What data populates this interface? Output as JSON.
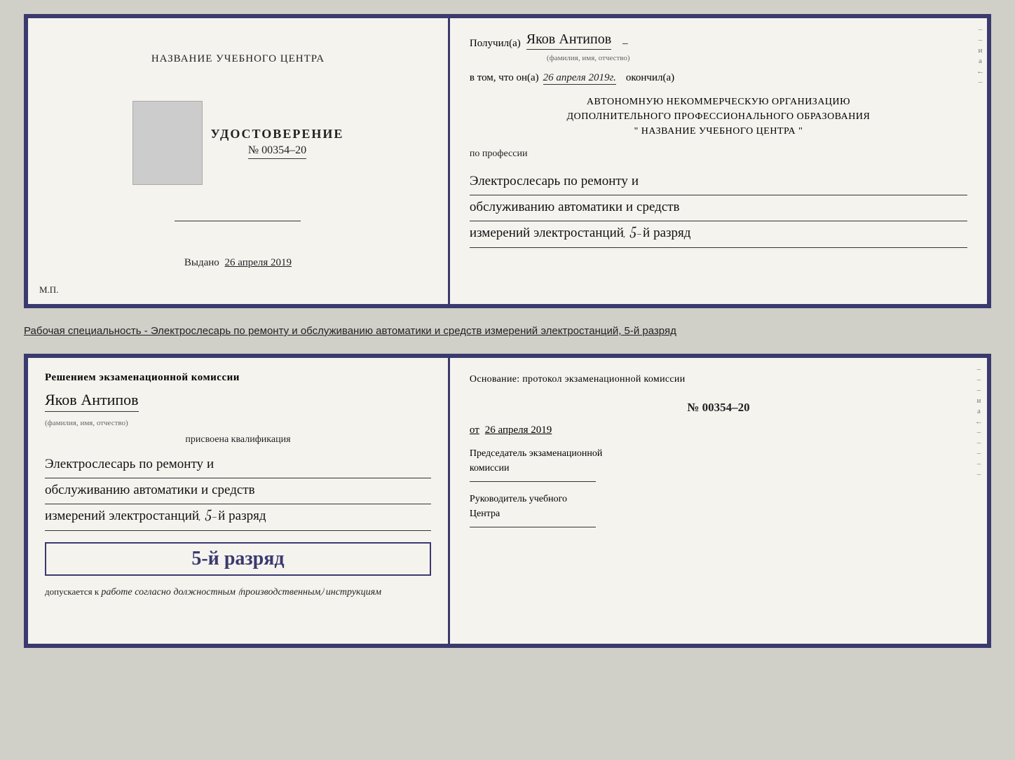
{
  "topDoc": {
    "left": {
      "centerTitle": "НАЗВАНИЕ УЧЕБНОГО ЦЕНТРА",
      "udost": {
        "title": "УДОСТОВЕРЕНИЕ",
        "number": "№ 00354–20"
      },
      "vydano": "Выдано",
      "vydano_date": "26 апреля 2019",
      "mp_label": "М.П."
    },
    "right": {
      "poluchil_prefix": "Получил(а)",
      "poluchil_name": "Яков Антипов",
      "fio_sub": "(фамилия, имя, отчество)",
      "vtom_prefix": "в том, что он(а)",
      "vtom_date": "26 апреля 2019г.",
      "okonchil": "окончил(а)",
      "org_line1": "АВТОНОМНУЮ НЕКОММЕРЧЕСКУЮ ОРГАНИЗАЦИЮ",
      "org_line2": "ДОПОЛНИТЕЛЬНОГО ПРОФЕССИОНАЛЬНОГО ОБРАЗОВАНИЯ",
      "org_line3": "\" НАЗВАНИЕ УЧЕБНОГО ЦЕНТРА \"",
      "po_professii": "по профессии",
      "profession_line1": "Электрослесарь по ремонту и",
      "profession_line2": "обслуживанию автоматики и средств",
      "profession_line3": "измерений электростанций, 5-й разряд"
    }
  },
  "separatorText": "Рабочая специальность - Электрослесарь по ремонту и обслуживанию автоматики и средств измерений электростанций, 5-й разряд",
  "bottomDoc": {
    "left": {
      "resheniem": "Решением экзаменационной комиссии",
      "name": "Яков Антипов",
      "fio_sub": "(фамилия, имя, отчество)",
      "prisvoena": "присвоена квалификация",
      "prof_line1": "Электрослесарь по ремонту и",
      "prof_line2": "обслуживанию автоматики и средств",
      "prof_line3": "измерений электростанций, 5-й разряд",
      "razryad_badge": "5-й разряд",
      "dopuskaetsya": "допускается к",
      "dopusk_italic": "работе согласно должностным (производственным) инструкциям"
    },
    "right": {
      "osnovanie": "Основание: протокол экзаменационной комиссии",
      "protocol_number": "№ 00354–20",
      "ot_prefix": "от",
      "ot_date": "26 апреля 2019",
      "predsedatel_line1": "Председатель экзаменационной",
      "predsedatel_line2": "комиссии",
      "rukovoditel_line1": "Руководитель учебного",
      "rukovoditel_line2": "Центра"
    }
  }
}
